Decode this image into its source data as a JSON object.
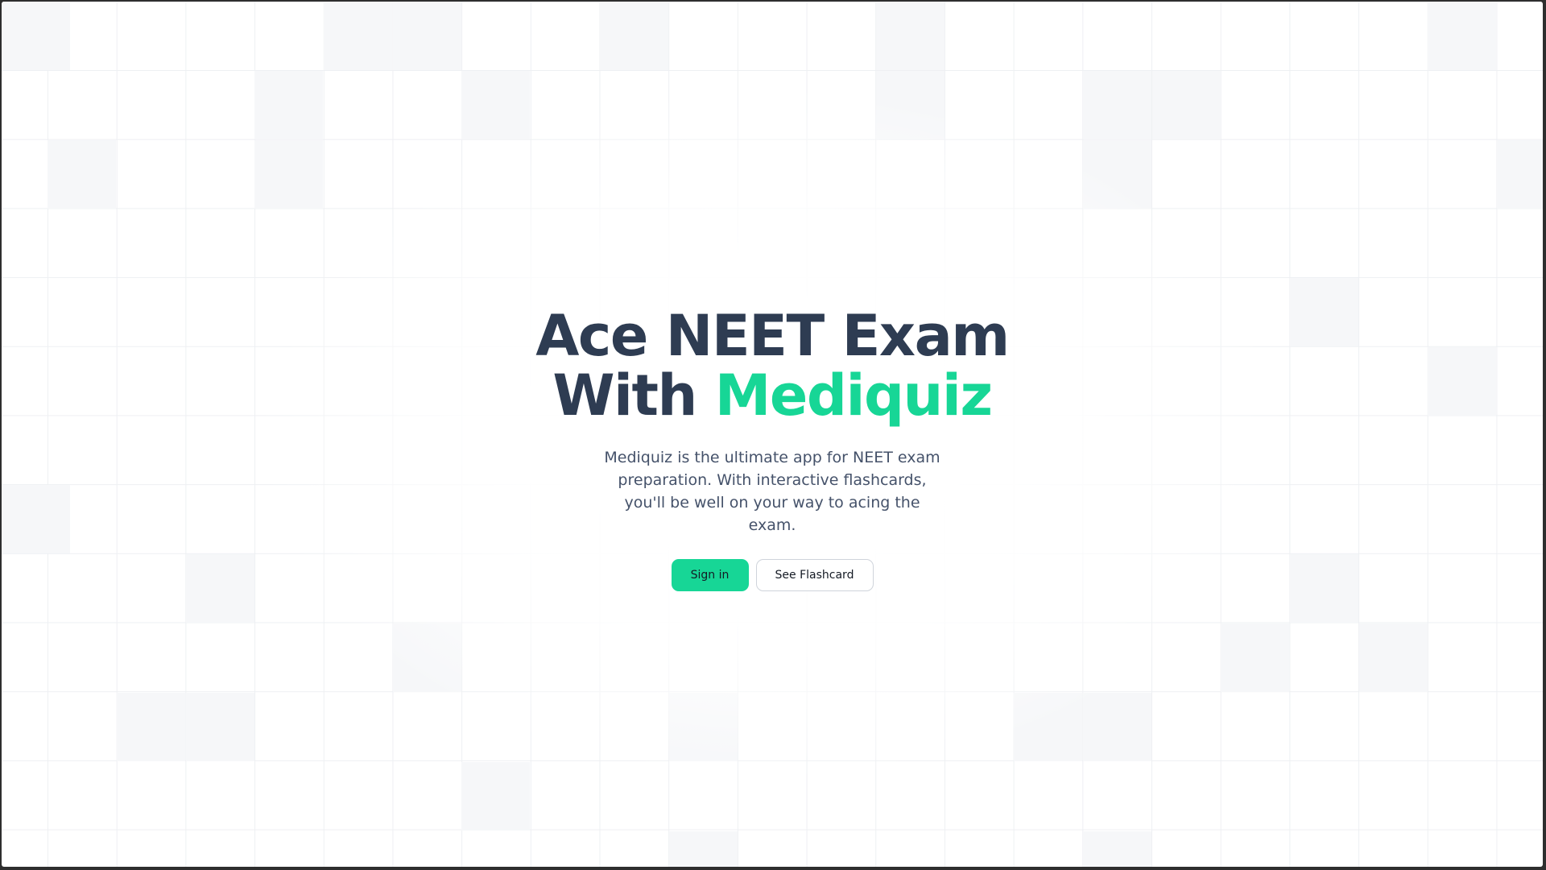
{
  "hero": {
    "headline_line1": "Ace NEET Exam",
    "headline_line2_prefix": "With ",
    "headline_brand": "Mediquiz",
    "subtitle_line1": "Mediquiz is the ultimate app for NEET exam",
    "subtitle_line2": "preparation. With interactive flashcards,",
    "subtitle_line3": "you'll be well on your way to acing the exam."
  },
  "actions": {
    "sign_in_label": "Sign in",
    "flashcard_label": "See Flashcard"
  },
  "colors": {
    "accent": "#17d696",
    "heading": "#2e3c52",
    "body_text": "#45526a",
    "grid_line": "#eef0f3"
  }
}
